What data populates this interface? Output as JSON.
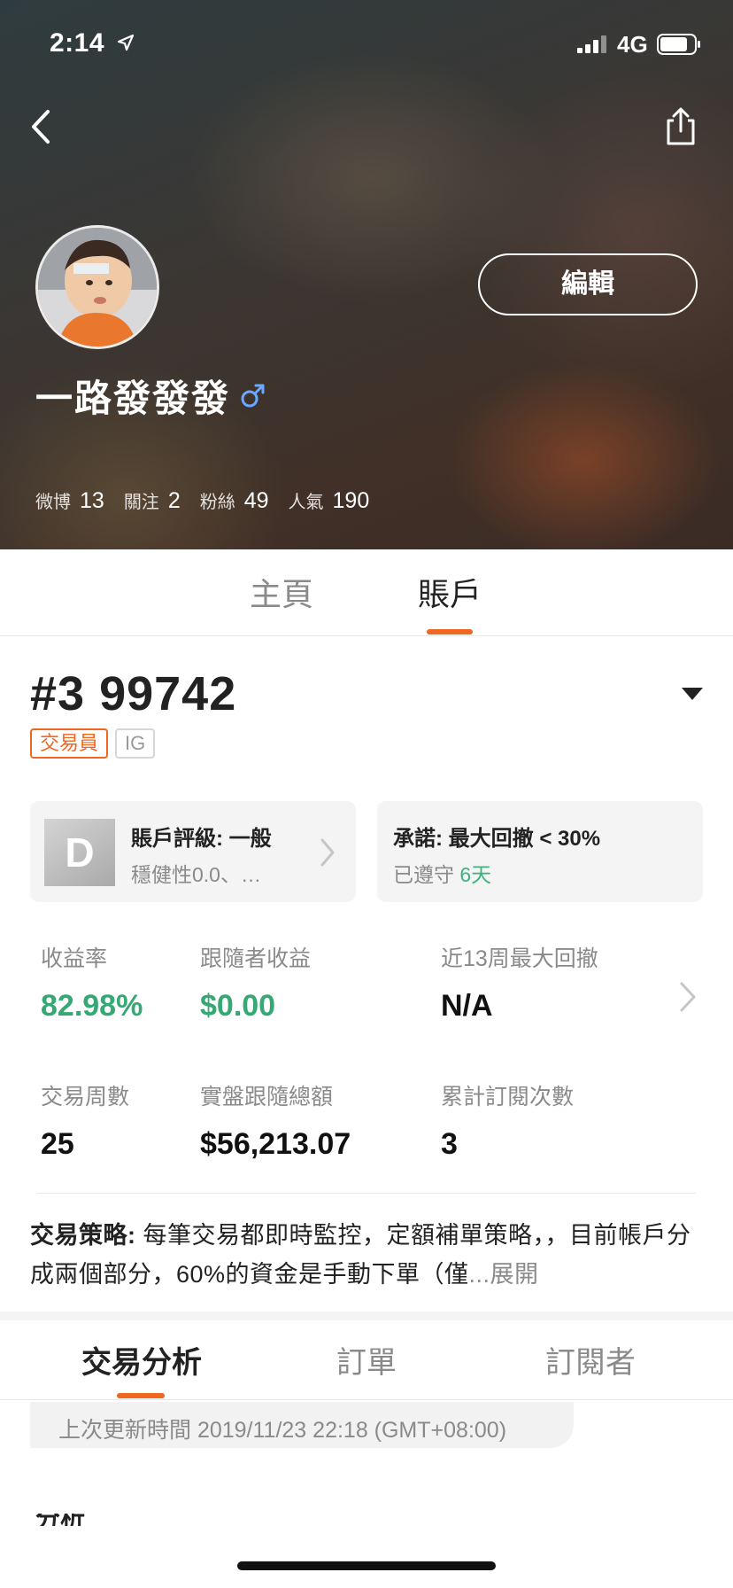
{
  "status_bar": {
    "time": "2:14",
    "network": "4G"
  },
  "header": {
    "edit_label": "編輯",
    "username": "一路發發發"
  },
  "stats": [
    {
      "label": "微博",
      "value": "13"
    },
    {
      "label": "關注",
      "value": "2"
    },
    {
      "label": "粉絲",
      "value": "49"
    },
    {
      "label": "人氣",
      "value": "190"
    }
  ],
  "main_tabs": {
    "home": "主頁",
    "account": "賬戶"
  },
  "account": {
    "id": "#3 99742",
    "tags": {
      "trader": "交易員",
      "broker": "IG"
    },
    "rating": {
      "grade": "D",
      "title": "賬戶評級: 一般",
      "subtitle": "穩健性0.0、…"
    },
    "commitment": {
      "title": "承諾: 最大回撤 < 30%",
      "kept_label": "已遵守",
      "kept_days": "6天"
    }
  },
  "metrics": {
    "return_rate": {
      "label": "收益率",
      "value": "82.98%"
    },
    "follower_profit": {
      "label": "跟隨者收益",
      "value": "$0.00"
    },
    "max_drawdown": {
      "label": "近13周最大回撤",
      "value": "N/A"
    },
    "trading_weeks": {
      "label": "交易周數",
      "value": "25"
    },
    "live_follow_total": {
      "label": "實盤跟隨總額",
      "value": "$56,213.07"
    },
    "subscription_count": {
      "label": "累計訂閱次數",
      "value": "3"
    }
  },
  "strategy": {
    "title": "交易策略:",
    "text": " 每筆交易都即時監控，定額補單策略，，目前帳戶分成兩個部分，60%的資金是手動下單（僅",
    "expand_label": "...展開"
  },
  "sub_tabs": {
    "analysis": "交易分析",
    "orders": "訂單",
    "subscribers": "訂閱者"
  },
  "update": {
    "text": "上次更新時間 2019/11/23 22:18 (GMT+08:00)"
  },
  "partial_text": "分析",
  "colors": {
    "accent": "#f06722",
    "positive": "#36a873",
    "muted": "#8a8a8a"
  }
}
